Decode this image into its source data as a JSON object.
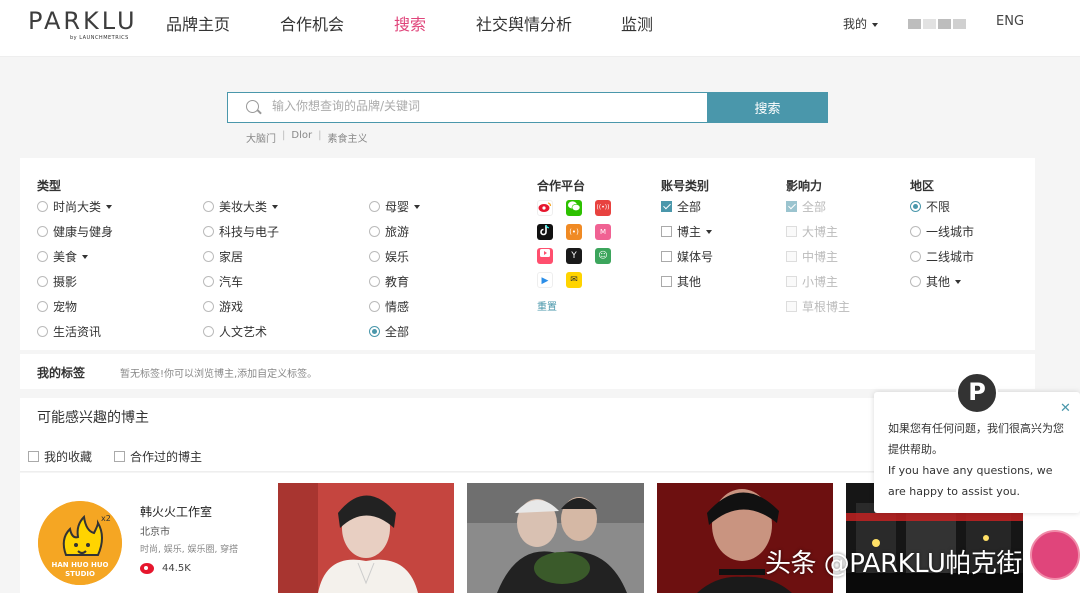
{
  "logo": {
    "main": "PARKLU",
    "sub": "by LAUNCHMETRICS"
  },
  "nav": {
    "items": [
      "品牌主页",
      "合作机会",
      "搜索",
      "社交舆情分析",
      "监测"
    ],
    "active": "搜索"
  },
  "header": {
    "me": "我的",
    "lang": "ENG"
  },
  "search": {
    "placeholder": "输入你想查询的品牌/关键词",
    "button": "搜索",
    "hot": [
      "大脑门",
      "Dlor",
      "素食主义"
    ]
  },
  "filters": {
    "type": {
      "title": "类型",
      "col1": [
        "时尚大类",
        "健康与健身",
        "美食",
        "摄影",
        "宠物",
        "生活资讯"
      ],
      "col2": [
        "美妆大类",
        "科技与电子",
        "家居",
        "汽车",
        "游戏",
        "人文艺术"
      ],
      "col3": [
        "母婴",
        "旅游",
        "娱乐",
        "教育",
        "情感",
        "全部"
      ]
    },
    "platform": {
      "title": "合作平台",
      "reset": "重置"
    },
    "account": {
      "title": "账号类别",
      "options": [
        "全部",
        "博主",
        "媒体号",
        "其他"
      ]
    },
    "influence": {
      "title": "影响力",
      "options": [
        "全部",
        "大博主",
        "中博主",
        "小博主",
        "草根博主"
      ]
    },
    "region": {
      "title": "地区",
      "options": [
        "不限",
        "一线城市",
        "二线城市",
        "其他"
      ]
    }
  },
  "tags": {
    "title": "我的标签",
    "empty": "暂无标签!你可以浏览博主,添加自定义标签。"
  },
  "recommend": {
    "title": "可能感兴趣的博主",
    "checks": [
      "我的收藏",
      "合作过的博主"
    ]
  },
  "kol": {
    "name": "韩火火工作室",
    "city": "北京市",
    "tags": "时尚, 娱乐, 娱乐圈, 穿搭",
    "followers": "44.5K",
    "avatar_text": "HAN HUO HUO STUDIO",
    "avatar_mark": "x2"
  },
  "chat": {
    "cn": "如果您有任何问题，我们很高兴为您提供帮助。",
    "en": "If you have any questions, we are happy to assist you.",
    "avatar": "P"
  },
  "watermark": "头条 @PARKLU帕克街",
  "colors": {
    "accent": "#4a97ab",
    "nav_active": "#e0457b"
  }
}
